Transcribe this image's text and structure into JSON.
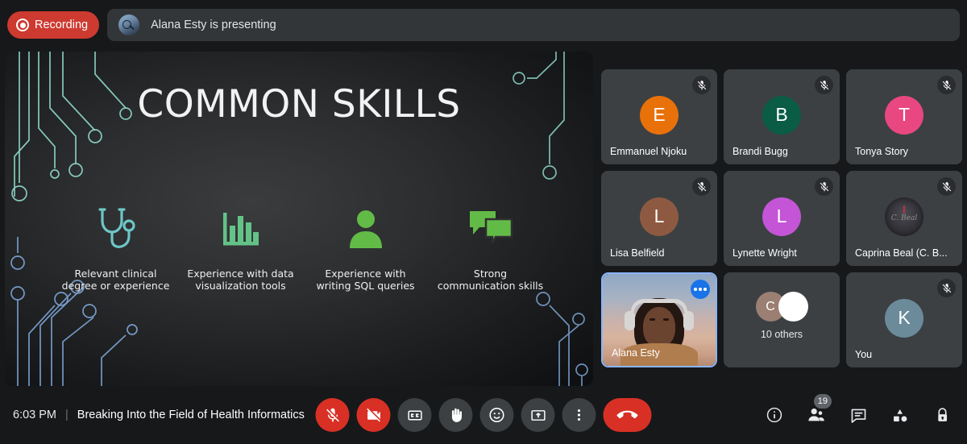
{
  "topbar": {
    "recording_label": "Recording",
    "recording_color": "#cd3a30",
    "presenting_text": "Alana Esty is presenting"
  },
  "slide": {
    "title": "COMMON SKILLS",
    "accent_teal": "#6ec6c6",
    "accent_green": "#66bb6a",
    "skills": [
      {
        "icon": "stethoscope-icon",
        "label": "Relevant clinical degree or experience",
        "color": "#6ec6c6"
      },
      {
        "icon": "bar-chart-icon",
        "label": "Experience with data visualization tools",
        "color": "#63c387"
      },
      {
        "icon": "person-icon",
        "label": "Experience with writing SQL queries",
        "color": "#62bb46"
      },
      {
        "icon": "chat-bubbles-icon",
        "label": "Strong communication skills",
        "color": "#62bb46"
      }
    ]
  },
  "participants": [
    {
      "name": "Emmanuel Njoku",
      "initial": "E",
      "color": "#e8710a",
      "muted": true,
      "type": "initial"
    },
    {
      "name": "Brandi Bugg",
      "initial": "B",
      "color": "#0b5c45",
      "muted": true,
      "type": "initial"
    },
    {
      "name": "Tonya Story",
      "initial": "T",
      "color": "#e8477f",
      "muted": true,
      "type": "initial"
    },
    {
      "name": "Lisa Belfield",
      "initial": "L",
      "color": "#8d5a41",
      "muted": true,
      "type": "initial"
    },
    {
      "name": "Lynette Wright",
      "initial": "L",
      "color": "#c455d6",
      "muted": true,
      "type": "initial"
    },
    {
      "name": "Caprina Beal (C. B...",
      "initial": "",
      "color": "#3a3a40",
      "muted": true,
      "type": "photo",
      "photo_caption": "C. Beal"
    },
    {
      "name": "Alana Esty",
      "initial": "",
      "color": "#8ab4f8",
      "muted": false,
      "type": "video",
      "active": true,
      "more_label": "more-options"
    },
    {
      "name": "10 others",
      "initial": "C",
      "color": "#9b7f72",
      "muted": false,
      "type": "others"
    },
    {
      "name": "You",
      "initial": "K",
      "color": "#6b8b9b",
      "muted": true,
      "type": "initial"
    }
  ],
  "bottombar": {
    "time": "6:03 PM",
    "separator": "|",
    "meeting_title": "Breaking Into the Field of Health Informatics",
    "controls": [
      {
        "name": "microphone-off-button",
        "icon": "mic-off-icon",
        "state": "muted",
        "danger": true
      },
      {
        "name": "camera-off-button",
        "icon": "video-off-icon",
        "state": "off",
        "danger": true
      },
      {
        "name": "captions-button",
        "icon": "closed-caption-icon",
        "danger": false
      },
      {
        "name": "raise-hand-button",
        "icon": "hand-icon",
        "danger": false
      },
      {
        "name": "reactions-button",
        "icon": "emoji-smile-icon",
        "danger": false
      },
      {
        "name": "present-now-button",
        "icon": "present-screen-icon",
        "danger": false
      },
      {
        "name": "more-options-button",
        "icon": "three-dots-vertical-icon",
        "danger": false
      },
      {
        "name": "leave-call-button",
        "icon": "phone-hangup-icon",
        "danger": true
      }
    ],
    "right_icons": [
      {
        "name": "meeting-details-button",
        "icon": "info-icon",
        "badge": ""
      },
      {
        "name": "people-button",
        "icon": "people-icon",
        "badge": "19"
      },
      {
        "name": "chat-button",
        "icon": "chat-icon",
        "badge": ""
      },
      {
        "name": "activities-button",
        "icon": "shapes-icon",
        "badge": ""
      },
      {
        "name": "host-controls-button",
        "icon": "lock-icon",
        "badge": ""
      }
    ]
  }
}
